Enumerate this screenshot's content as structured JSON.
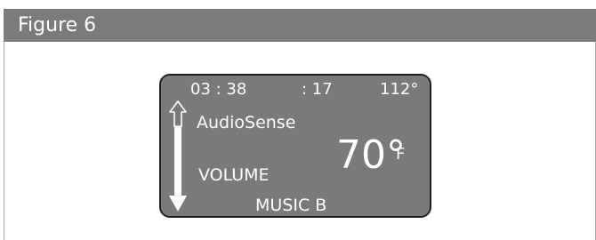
{
  "figure": {
    "title": "Figure 6"
  },
  "display": {
    "clock": "03 : 38",
    "seconds": ": 17",
    "heading": "112°",
    "audio_mode": "AudioSense",
    "volume_label": "VOLUME",
    "temperature_value": "70°",
    "temperature_unit": "F",
    "music_source": "MUSIC B",
    "icons": [
      "volume-up-down-arrow-icon"
    ]
  }
}
